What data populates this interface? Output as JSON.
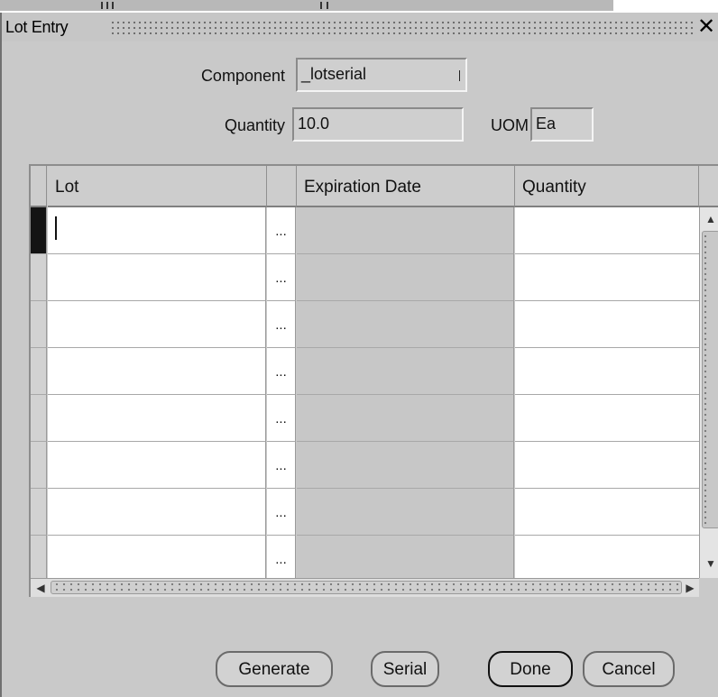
{
  "window": {
    "title": "Lot Entry"
  },
  "form": {
    "component_label": "Component",
    "component_value": "_lotserial",
    "quantity_label": "Quantity",
    "quantity_value": "10.0",
    "uom_label": "UOM",
    "uom_value": "Ea"
  },
  "grid": {
    "columns": [
      "Lot",
      "Expiration Date",
      "Quantity"
    ],
    "lov_button": "...",
    "rows": [
      {
        "lot": "",
        "expiration_date": "",
        "quantity": ""
      },
      {
        "lot": "",
        "expiration_date": "",
        "quantity": ""
      },
      {
        "lot": "",
        "expiration_date": "",
        "quantity": ""
      },
      {
        "lot": "",
        "expiration_date": "",
        "quantity": ""
      },
      {
        "lot": "",
        "expiration_date": "",
        "quantity": ""
      },
      {
        "lot": "",
        "expiration_date": "",
        "quantity": ""
      },
      {
        "lot": "",
        "expiration_date": "",
        "quantity": ""
      },
      {
        "lot": "",
        "expiration_date": "",
        "quantity": ""
      }
    ]
  },
  "buttons": {
    "generate": "Generate",
    "serial": "Serial",
    "done": "Done",
    "cancel": "Cancel"
  },
  "icons": {
    "close": "close-icon",
    "scroll_up": "scroll-up-icon",
    "scroll_down": "scroll-down-icon",
    "scroll_left": "scroll-left-icon",
    "scroll_right": "scroll-right-icon"
  },
  "colors": {
    "window_bg": "#c9c9c9",
    "field_bg": "#cfcfcf",
    "current_row_indicator": "#141414"
  }
}
